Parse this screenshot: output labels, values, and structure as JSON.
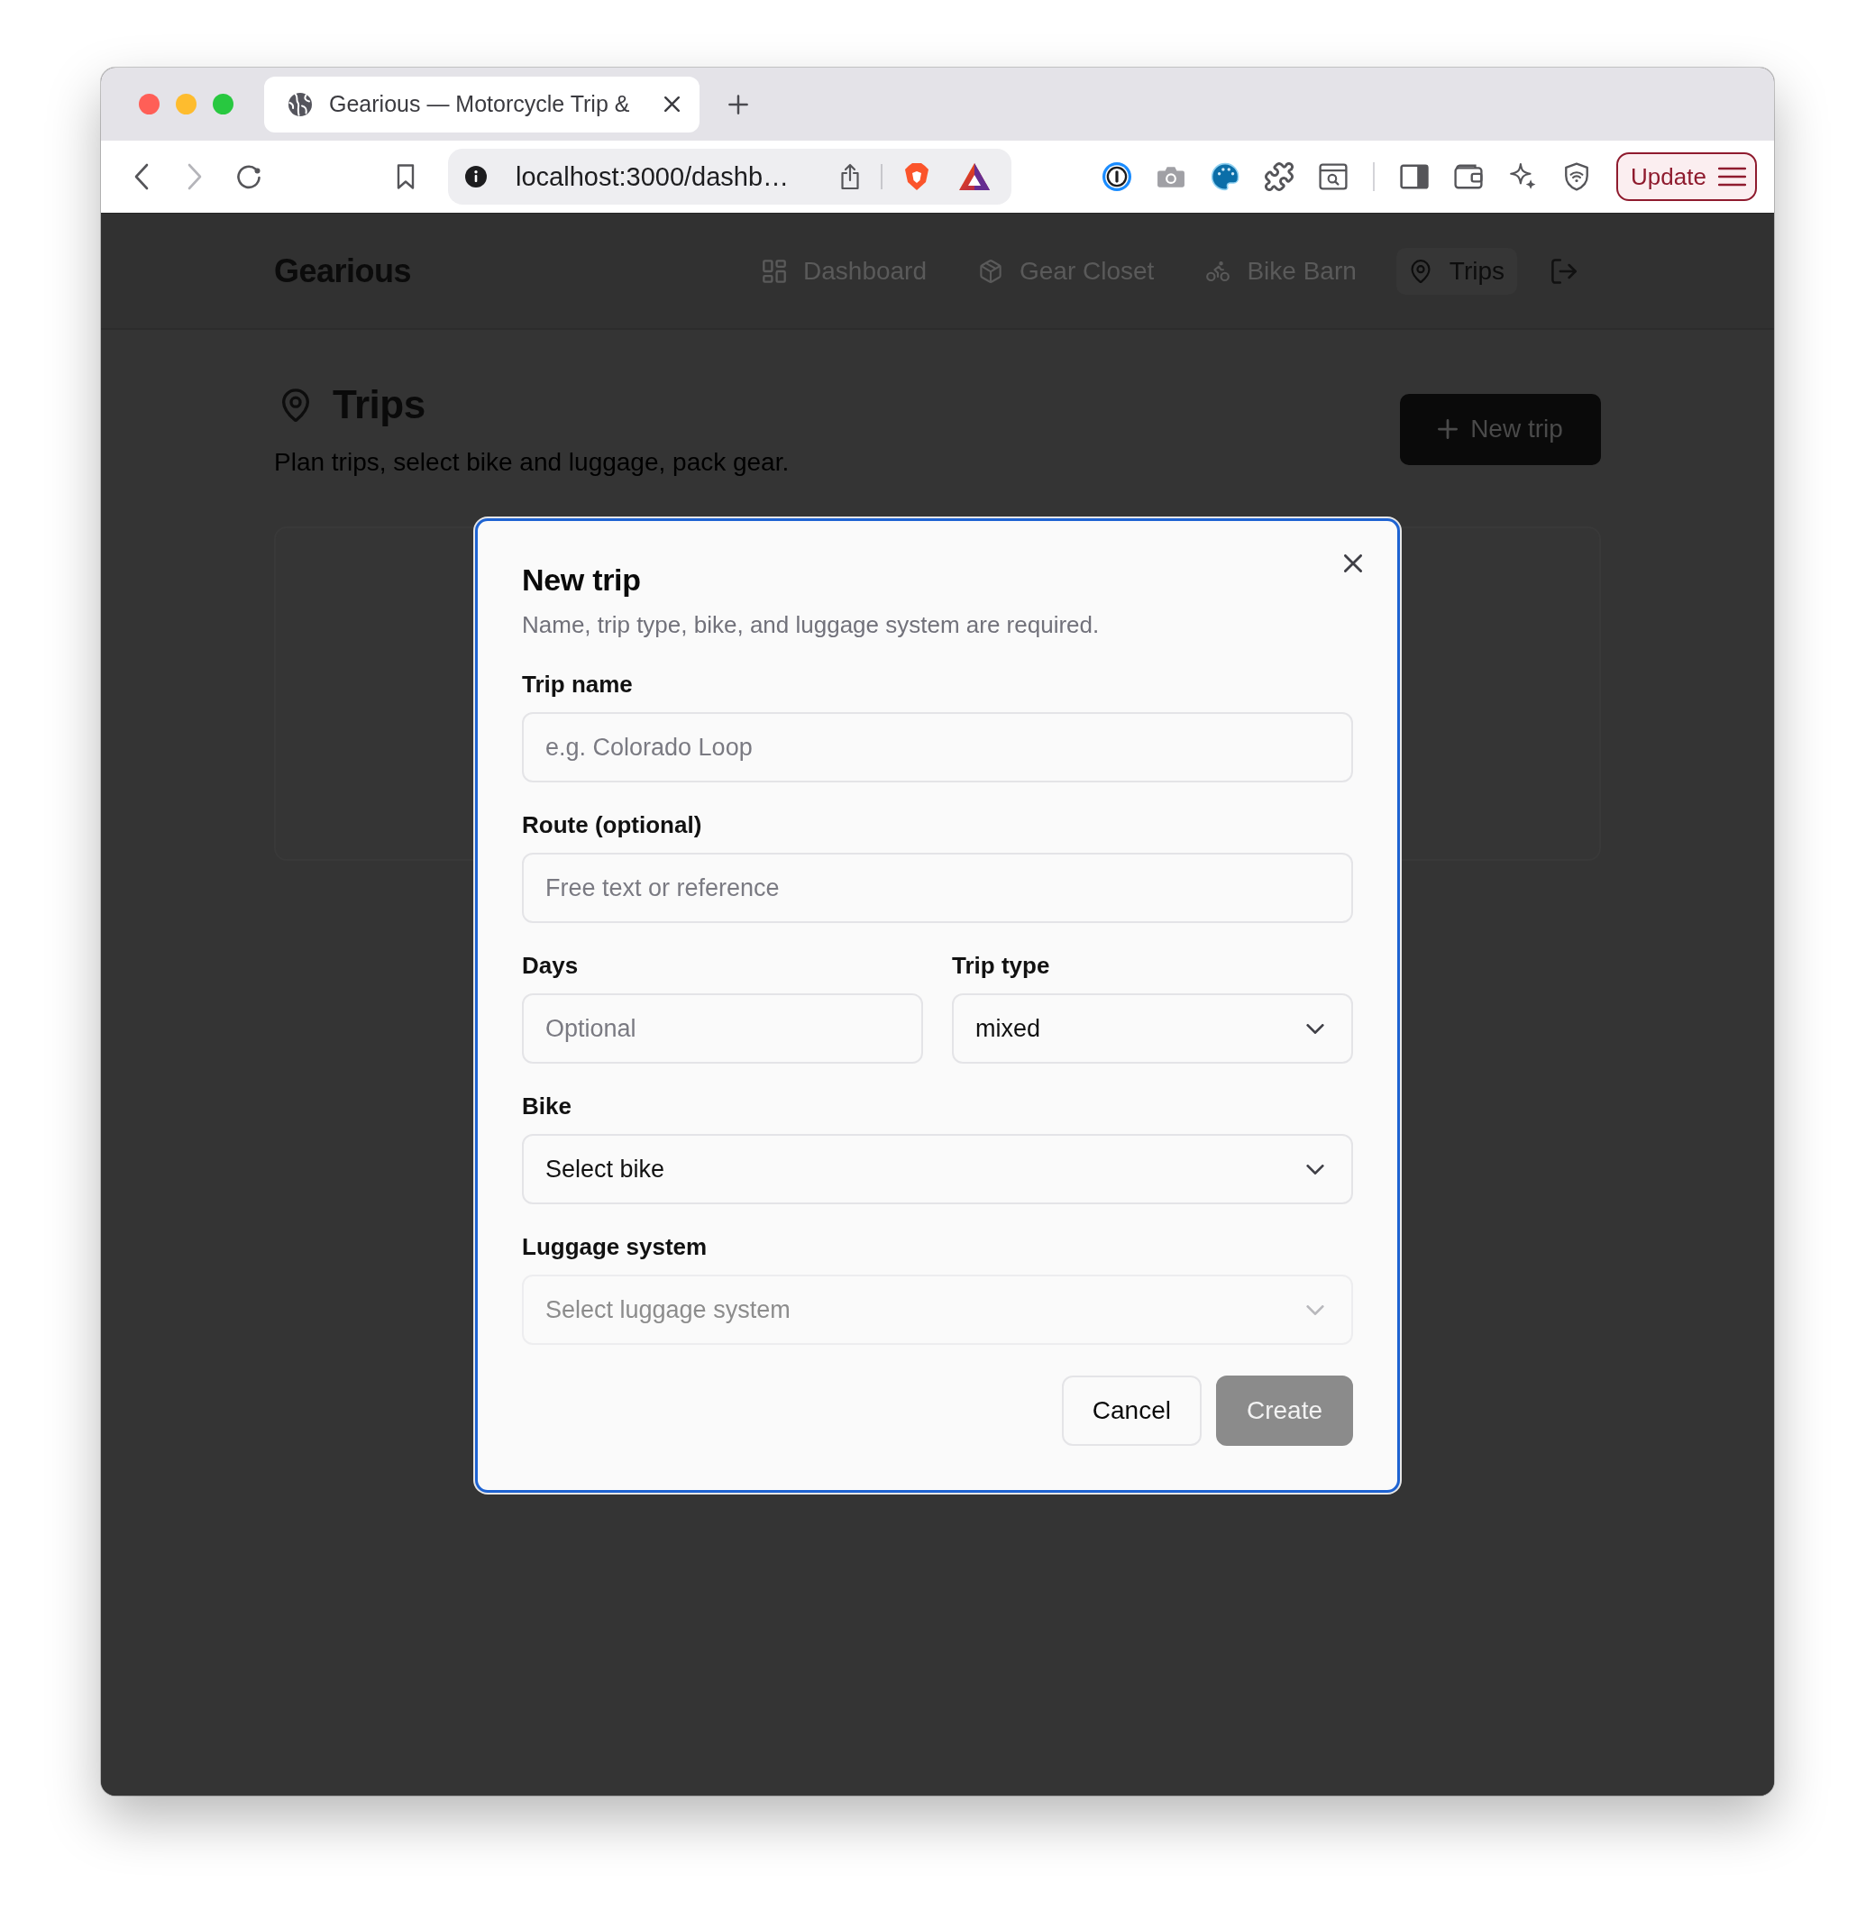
{
  "browser": {
    "tab": {
      "title": "Gearious — Motorcycle Trip &"
    },
    "address_bar": {
      "url": "localhost:3000/dashb…"
    },
    "update_button": {
      "label": "Update"
    }
  },
  "app": {
    "brand": "Gearious",
    "nav": [
      {
        "label": "Dashboard",
        "selected": false
      },
      {
        "label": "Gear Closet",
        "selected": false
      },
      {
        "label": "Bike Barn",
        "selected": false
      },
      {
        "label": "Trips",
        "selected": true
      }
    ],
    "page": {
      "title": "Trips",
      "subtitle": "Plan trips, select bike and luggage, pack gear.",
      "new_button": "New trip"
    }
  },
  "dialog": {
    "title": "New trip",
    "description": "Name, trip type, bike, and luggage system are required.",
    "field_rows": [
      [
        {
          "label": "Trip name",
          "kind": "text",
          "placeholder": "e.g. Colorado Loop",
          "disabled": false
        }
      ],
      [
        {
          "label": "Route (optional)",
          "kind": "text",
          "placeholder": "Free text or reference",
          "disabled": false
        }
      ],
      [
        {
          "label": "Days",
          "kind": "text",
          "placeholder": "Optional",
          "disabled": false
        },
        {
          "label": "Trip type",
          "kind": "select",
          "value": "mixed",
          "disabled": false
        }
      ],
      [
        {
          "label": "Bike",
          "kind": "select",
          "value": "Select bike",
          "disabled": false
        }
      ],
      [
        {
          "label": "Luggage system",
          "kind": "select",
          "value": "Select luggage system",
          "disabled": true
        }
      ]
    ],
    "buttons": [
      {
        "label": "Cancel",
        "kind": "secondary",
        "disabled": false
      },
      {
        "label": "Create",
        "kind": "primary",
        "disabled": true
      }
    ]
  }
}
